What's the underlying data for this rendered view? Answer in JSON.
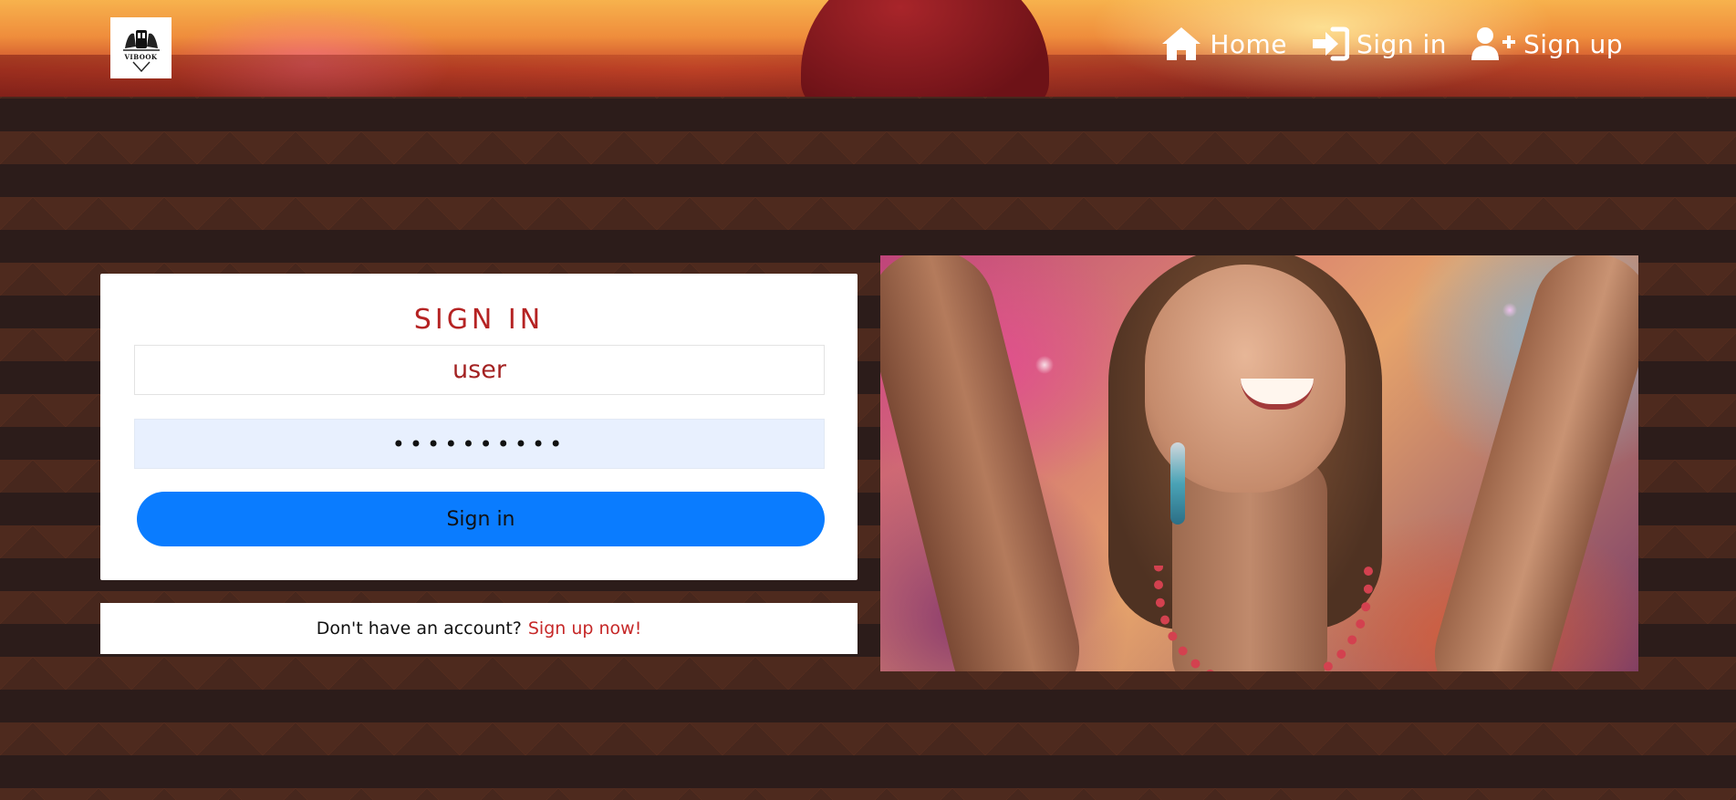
{
  "header": {
    "logo_text": "VIBOOK",
    "nav": [
      {
        "label": "Home",
        "icon": "home-icon"
      },
      {
        "label": "Sign in",
        "icon": "sign-in-icon"
      },
      {
        "label": "Sign up",
        "icon": "user-plus-icon"
      }
    ]
  },
  "signin": {
    "title": "SIGN IN",
    "username_value": "user",
    "password_value": "••••••••••",
    "button_label": "Sign in"
  },
  "signup_prompt": {
    "text": "Don't have an account?",
    "link_label": "Sign up now!"
  },
  "colors": {
    "accent_red": "#b52323",
    "button_blue": "#0a7cff",
    "link_red": "#c62828",
    "background": "#2c1c1a"
  }
}
